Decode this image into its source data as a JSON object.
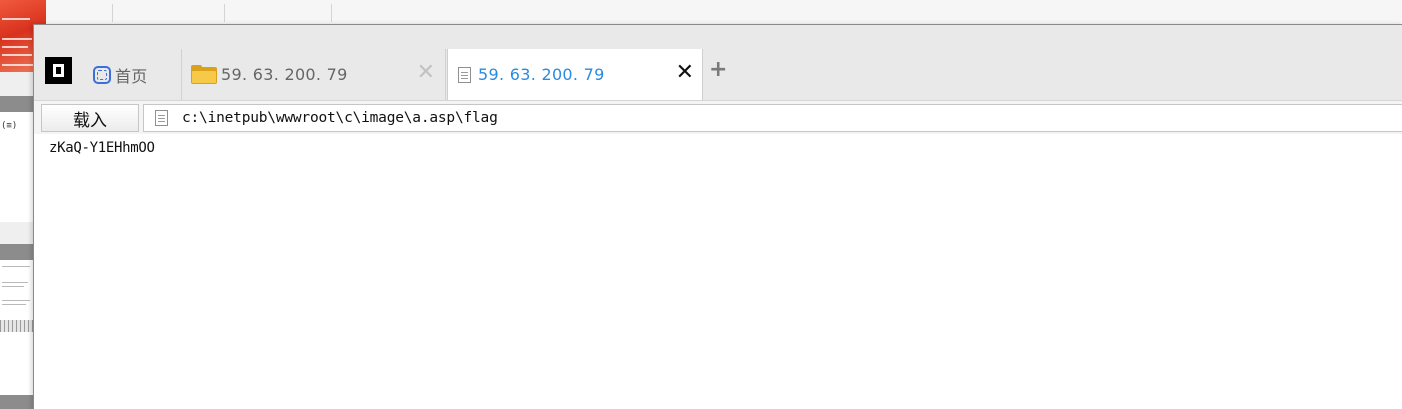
{
  "background_window": {
    "side_text": "(≡)"
  },
  "tabs": [
    {
      "label": "首页",
      "icon": "home-icon",
      "active": false,
      "closable": false
    },
    {
      "label": "59. 63. 200. 79",
      "icon": "folder-icon",
      "active": false,
      "closable": true
    },
    {
      "label": "59. 63. 200. 79",
      "icon": "document-icon",
      "active": true,
      "closable": true
    }
  ],
  "tab_close_glyph": "✕",
  "new_tab_glyph": "+",
  "address_bar": {
    "load_button_label": "载入",
    "path": "c:\\inetpub\\wwwroot\\c\\image\\a.asp\\flag"
  },
  "content": {
    "text": "zKaQ-Y1EHhmOO"
  },
  "colors": {
    "active_tab_text": "#2a8be0",
    "inactive_tab_text": "#666666",
    "folder_icon": "#f7c948",
    "home_icon": "#3c6fd8"
  }
}
